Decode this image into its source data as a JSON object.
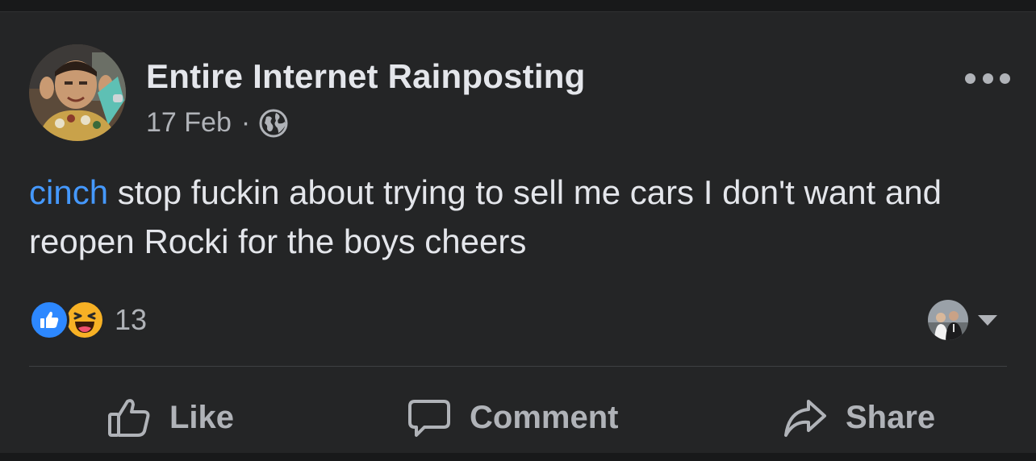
{
  "post": {
    "author": "Entire Internet Rainposting",
    "date": "17 Feb",
    "separator": "·",
    "privacy_icon": "globe-icon",
    "more_icon": "more-options-icon",
    "body": {
      "mention": "cinch",
      "text": " stop fuckin about trying to sell me cars I don't want and reopen Rocki for the boys cheers"
    },
    "reactions": {
      "types": [
        "like",
        "haha"
      ],
      "count": "13"
    },
    "reaction_selector_icon": "caret-down-icon",
    "actions": {
      "like": "Like",
      "comment": "Comment",
      "share": "Share"
    }
  },
  "colors": {
    "background": "#242526",
    "text": "#e4e6eb",
    "muted": "#b0b3b8",
    "mention": "#4599ff",
    "like_blue": "#2d88ff",
    "haha_yellow": "#f7b125"
  }
}
